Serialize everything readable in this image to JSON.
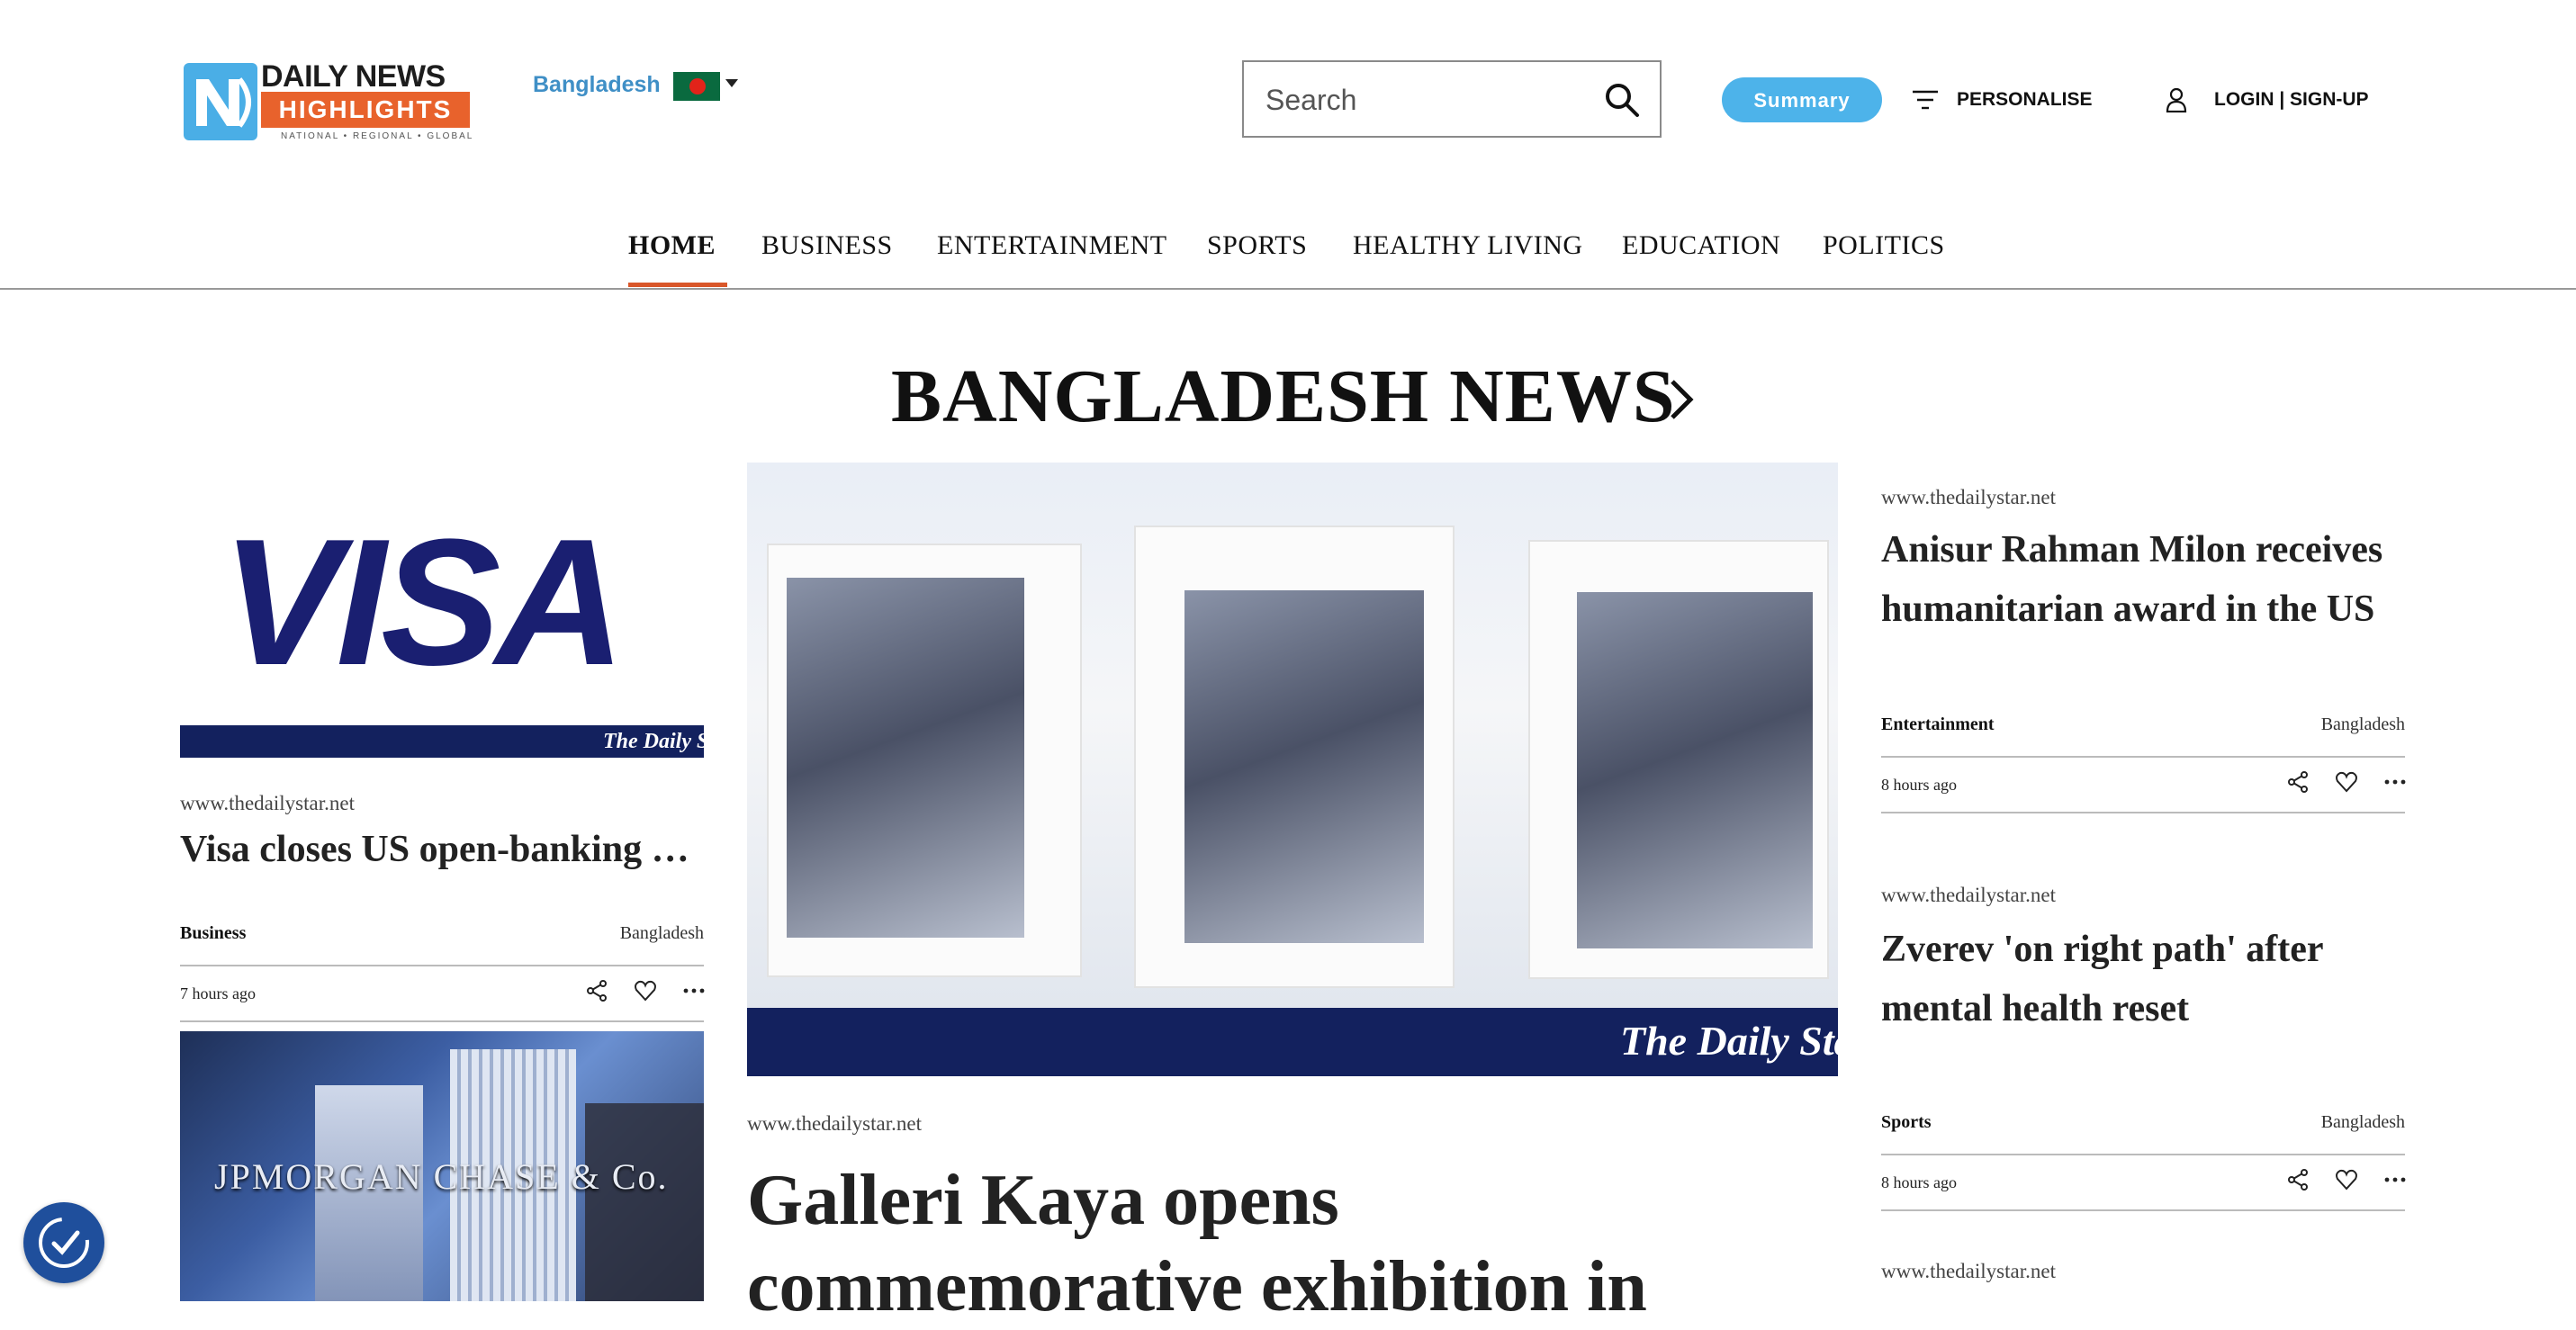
{
  "header": {
    "logo": {
      "line1": "DAILY NEWS",
      "line2": "HIGHLIGHTS",
      "tagline": "NATIONAL • REGIONAL • GLOBAL"
    },
    "country": "Bangladesh",
    "search": {
      "placeholder": "Search",
      "value": ""
    },
    "summary_label": "Summary",
    "personalise_label": "PERSONALISE",
    "login_label": "LOGIN | SIGN-UP"
  },
  "nav": {
    "items": [
      "HOME",
      "BUSINESS",
      "ENTERTAINMENT",
      "SPORTS",
      "HEALTHY LIVING",
      "EDUCATION",
      "POLITICS"
    ],
    "active": "HOME"
  },
  "section": {
    "title": "BANGLADESH NEWS"
  },
  "articles": {
    "left1": {
      "image_text": "VISA",
      "watermark": "The Daily Star",
      "source": "www.thedailystar.net",
      "headline": "Visa closes US open-banking deal",
      "category": "Business",
      "region": "Bangladesh",
      "time": "7 hours ago"
    },
    "left2": {
      "image_text": "JPMORGAN CHASE & Co."
    },
    "center": {
      "watermark": "The Daily Star",
      "source": "www.thedailystar.net",
      "headline": "Galleri Kaya opens commemorative exhibition in"
    },
    "right1": {
      "source": "www.thedailystar.net",
      "headline": "Anisur Rahman Milon receives humanitarian award in the US",
      "category": "Entertainment",
      "region": "Bangladesh",
      "time": "8 hours ago"
    },
    "right2": {
      "source": "www.thedailystar.net",
      "headline": "Zverev 'on right path' after mental health reset",
      "category": "Sports",
      "region": "Bangladesh",
      "time": "8 hours ago"
    },
    "right3": {
      "source": "www.thedailystar.net"
    }
  },
  "colors": {
    "accent_orange": "#e8622c",
    "summary_blue": "#4db3ea",
    "country_blue": "#3f8fc6",
    "daily_star_navy": "#13215e",
    "visa_blue": "#1a1f71"
  },
  "icons": [
    "search-icon",
    "filter-icon",
    "user-icon",
    "chevron-right-icon",
    "share-icon",
    "heart-icon",
    "more-icon",
    "accessibility-icon"
  ]
}
